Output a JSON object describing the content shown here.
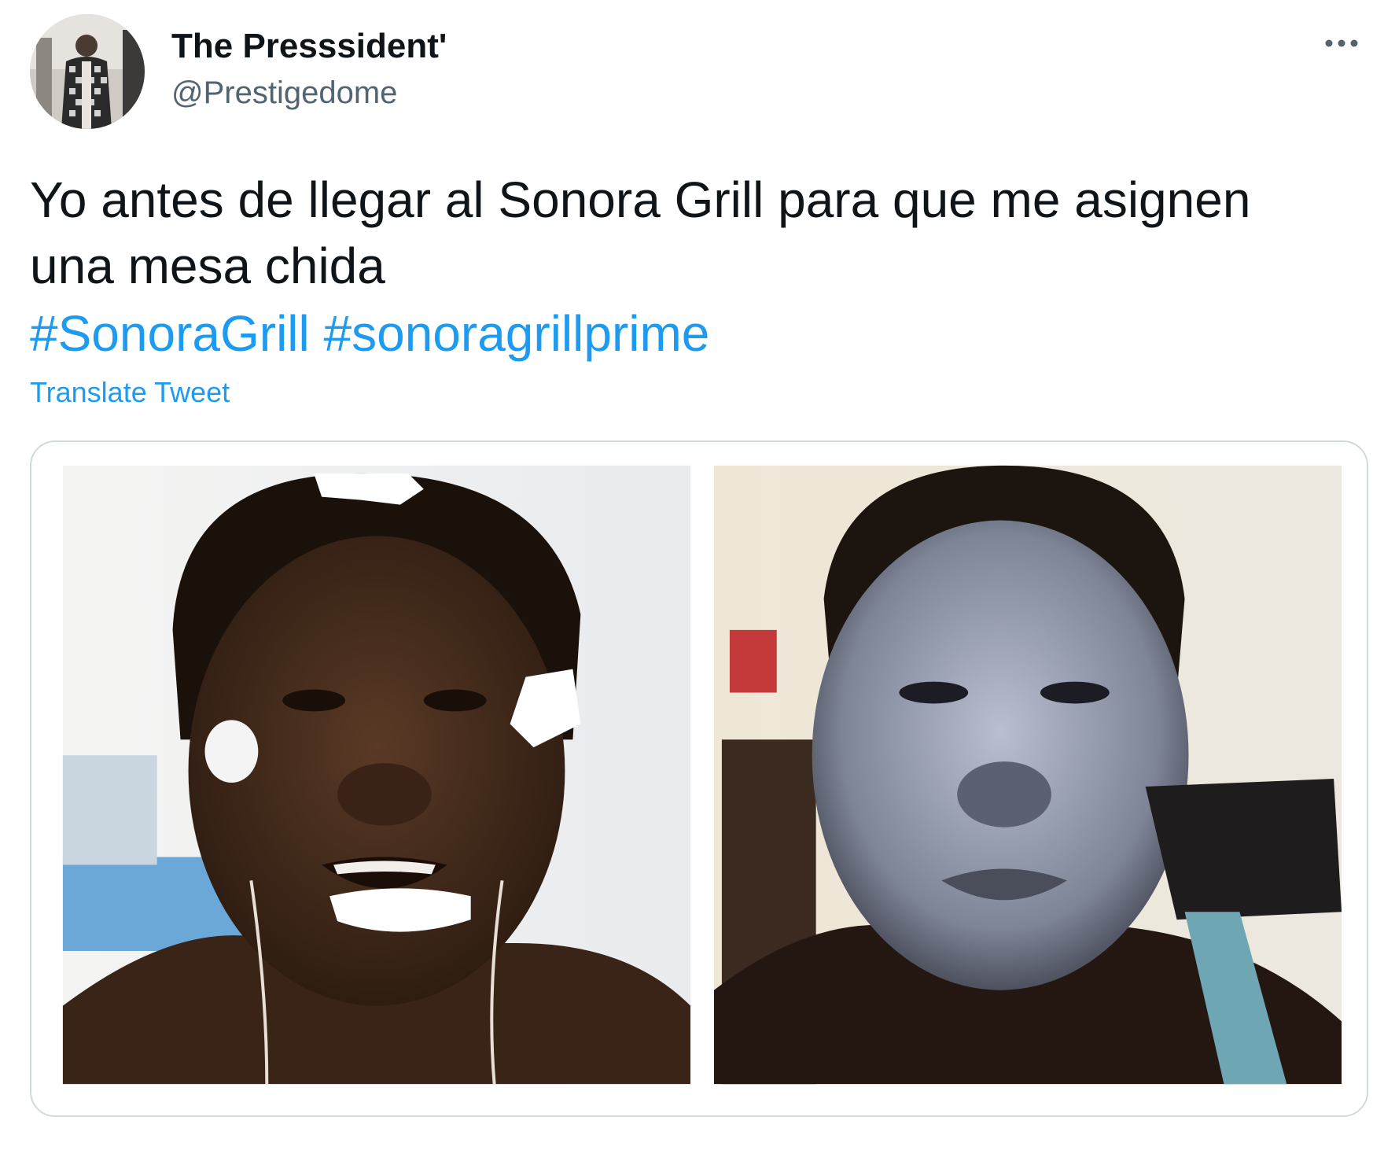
{
  "author": {
    "display_name": "The Presssident'",
    "handle": "@Prestigedome",
    "avatar_icon": "profile-photo"
  },
  "menu": {
    "more_icon": "ellipsis-icon"
  },
  "tweet": {
    "text_line_1": "Yo antes de llegar al Sonora Grill para que me asignen",
    "text_line_2": "una mesa chida",
    "hashtags": [
      "#SonoraGrill",
      "#sonoragrillprime"
    ],
    "translate_label": "Translate Tweet"
  },
  "media": {
    "type": "photo",
    "panels": 2
  },
  "colors": {
    "text": "#0f1419",
    "secondary": "#536471",
    "link": "#1d9bf0",
    "border": "#cfd9de"
  }
}
